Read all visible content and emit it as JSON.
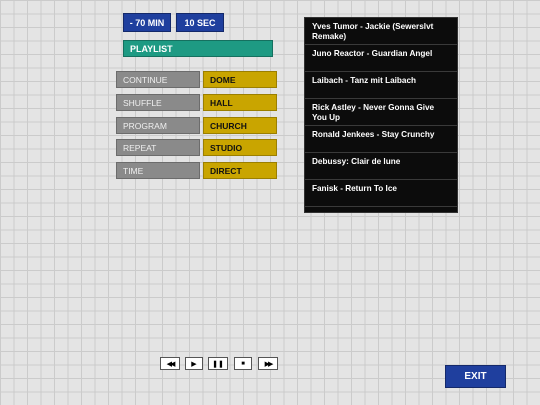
{
  "timer": {
    "minutes_label": "- 70 MIN",
    "seconds_label": "10 SEC"
  },
  "playlist_label": "PLAYLIST",
  "modes": [
    {
      "mode": "CONTINUE",
      "option": "DOME"
    },
    {
      "mode": "SHUFFLE",
      "option": "HALL"
    },
    {
      "mode": "PROGRAM",
      "option": "CHURCH"
    },
    {
      "mode": "REPEAT",
      "option": "STUDIO"
    },
    {
      "mode": "TIME",
      "option": "DIRECT"
    }
  ],
  "tracks": [
    "Yves Tumor - Jackie (Sewerslvt Remake)",
    "Juno Reactor - Guardian Angel",
    "Laibach - Tanz mit Laibach",
    "Rick Astley - Never Gonna Give You Up",
    "Ronald Jenkees - Stay Crunchy",
    "Debussy: Clair de lune",
    "Fanisk - Return To Ice"
  ],
  "transport": {
    "rewind": "◀◀",
    "play": "▶",
    "pause": "❚❚",
    "stop": "■",
    "forward": "▶▶"
  },
  "exit_label": "EXIT"
}
